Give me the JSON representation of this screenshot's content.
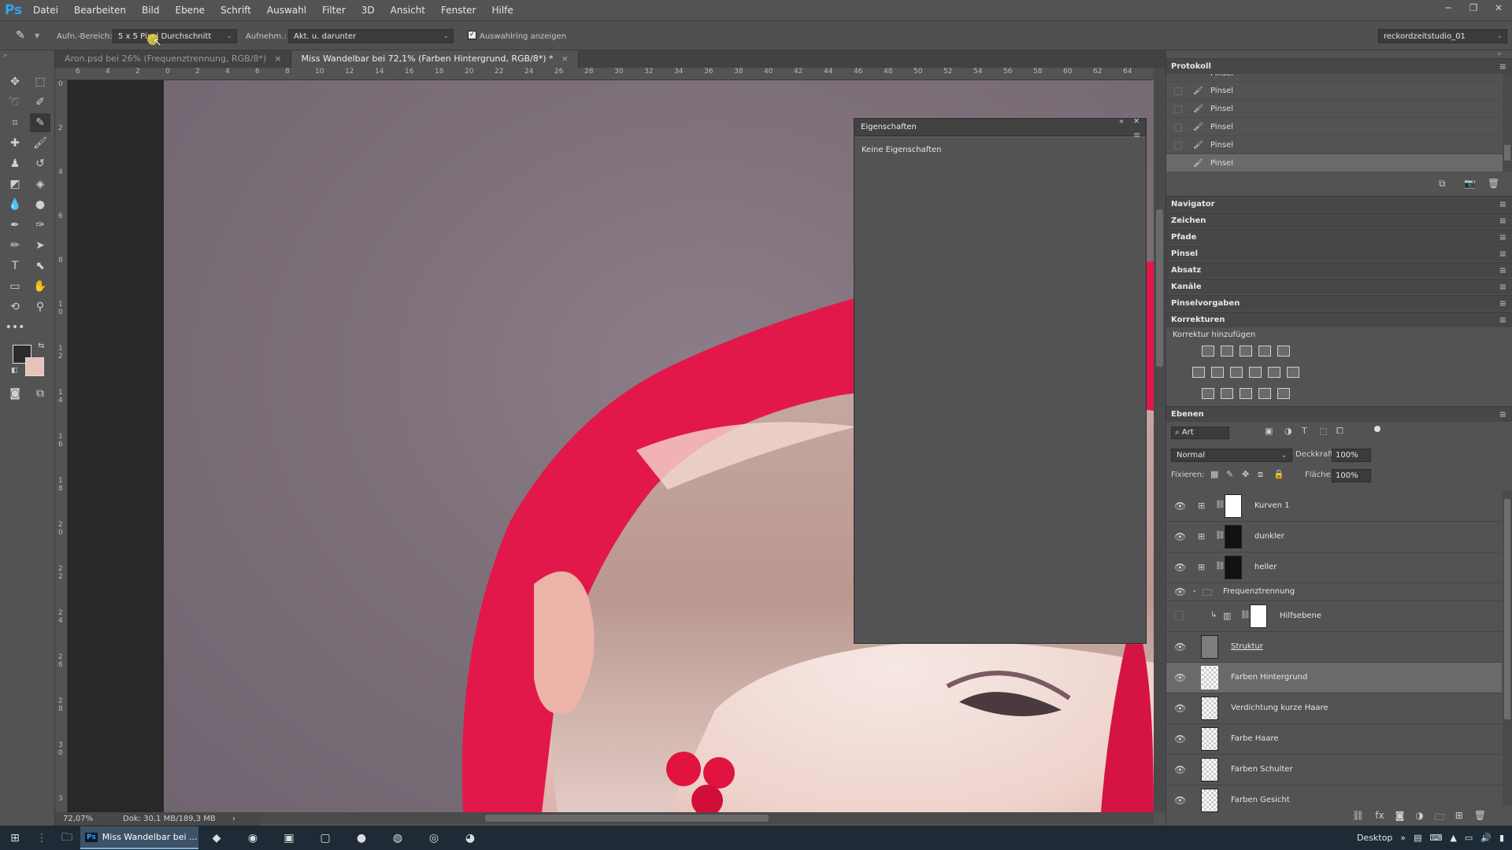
{
  "app": {
    "logo": "Ps"
  },
  "menu": [
    "Datei",
    "Bearbeiten",
    "Bild",
    "Ebene",
    "Schrift",
    "Auswahl",
    "Filter",
    "3D",
    "Ansicht",
    "Fenster",
    "Hilfe"
  ],
  "window_controls": {
    "minimize": "─",
    "restore": "❐",
    "close": "✕"
  },
  "options": {
    "sample_size_label": "Aufn.-Bereich:",
    "sample_size_value": "5 x 5 Pixel Durchschnitt",
    "sample_label": "Aufnehm.:",
    "sample_value": "Akt. u. darunter",
    "show_ring_label": "Auswahlring anzeigen",
    "show_ring_checked": true,
    "workspace_value": "reckordzeitstudio_01"
  },
  "doc_tabs": [
    {
      "label": "Aron.psd bei 26% (Frequenztrennung, RGB/8*)",
      "active": false
    },
    {
      "label": "Miss Wandelbar bei 72,1% (Farben Hintergrund, RGB/8*) *",
      "active": true
    }
  ],
  "ruler_top": [
    "6",
    "4",
    "2",
    "0",
    "2",
    "4",
    "6",
    "8",
    "10",
    "12",
    "14",
    "16",
    "18",
    "20",
    "22",
    "24",
    "26",
    "28",
    "30",
    "32",
    "34",
    "36",
    "38",
    "40",
    "42",
    "44",
    "46",
    "48",
    "50",
    "52",
    "54",
    "56",
    "58",
    "60",
    "62",
    "64"
  ],
  "ruler_left": [
    "0",
    "2",
    "4",
    "6",
    "8",
    "1 0",
    "1 2",
    "1 4",
    "1 6",
    "1 8",
    "2 0",
    "2 2",
    "2 4",
    "2 6",
    "2 8",
    "3 0",
    "3"
  ],
  "status": {
    "zoom": "72,07%",
    "doc": "Dok: 30,1 MB/189,3 MB",
    "arrow": "›"
  },
  "properties": {
    "title": "Eigenschaften",
    "empty_text": "Keine Eigenschaften",
    "collapse": "«",
    "close": "✕"
  },
  "history": {
    "title": "Protokoll",
    "items": [
      {
        "label": "Pinsel",
        "selected": false,
        "partial": true
      },
      {
        "label": "Pinsel",
        "selected": false
      },
      {
        "label": "Pinsel",
        "selected": false
      },
      {
        "label": "Pinsel",
        "selected": false
      },
      {
        "label": "Pinsel",
        "selected": false
      },
      {
        "label": "Pinsel",
        "selected": true
      }
    ]
  },
  "collapsed_panels": [
    "Navigator",
    "Zeichen",
    "Pfade",
    "Pinsel",
    "Absatz",
    "Kanäle",
    "Pinselvorgaben",
    "Korrekturen"
  ],
  "corrections": {
    "add_label": "Korrektur hinzufügen"
  },
  "layers": {
    "title": "Ebenen",
    "filter_value": "Art",
    "blend_mode": "Normal",
    "opacity_label": "Deckkraft:",
    "opacity_value": "100%",
    "lock_label": "Fixieren:",
    "fill_label": "Fläche:",
    "fill_value": "100%",
    "items": [
      {
        "name": "Kurven 1",
        "visible": true,
        "adjustment": true,
        "mask": "white",
        "indent": 0
      },
      {
        "name": "dunkler",
        "visible": true,
        "adjustment": true,
        "mask": "black",
        "indent": 0
      },
      {
        "name": "heller",
        "visible": true,
        "adjustment": true,
        "mask": "black",
        "indent": 0
      },
      {
        "name": "Frequenztrennung",
        "visible": true,
        "group": true,
        "indent": 0
      },
      {
        "name": "Hilfsebene",
        "visible": false,
        "adjustment": true,
        "mask": "white",
        "indent": 1
      },
      {
        "name": "Struktur",
        "visible": true,
        "thumb": "gray",
        "indent": 0
      },
      {
        "name": "Farben Hintergrund",
        "visible": true,
        "thumb": "checker",
        "indent": 0,
        "selected": true
      },
      {
        "name": "Verdichtung kurze Haare",
        "visible": true,
        "thumb": "checker",
        "indent": 0
      },
      {
        "name": "Farbe Haare",
        "visible": true,
        "thumb": "checker",
        "indent": 0
      },
      {
        "name": "Farben Schulter",
        "visible": true,
        "thumb": "checker",
        "indent": 0
      },
      {
        "name": "Farben Gesicht",
        "visible": true,
        "thumb": "checker",
        "indent": 0
      }
    ]
  },
  "taskbar": {
    "active_app": "Miss Wandelbar bei ...",
    "desktop_label": "Desktop",
    "show_more": "»"
  },
  "colors": {
    "accent": "#32a4f3",
    "foreground": "#2b2b2b",
    "background": "#e7c2b8",
    "hair": "#e8204f"
  }
}
